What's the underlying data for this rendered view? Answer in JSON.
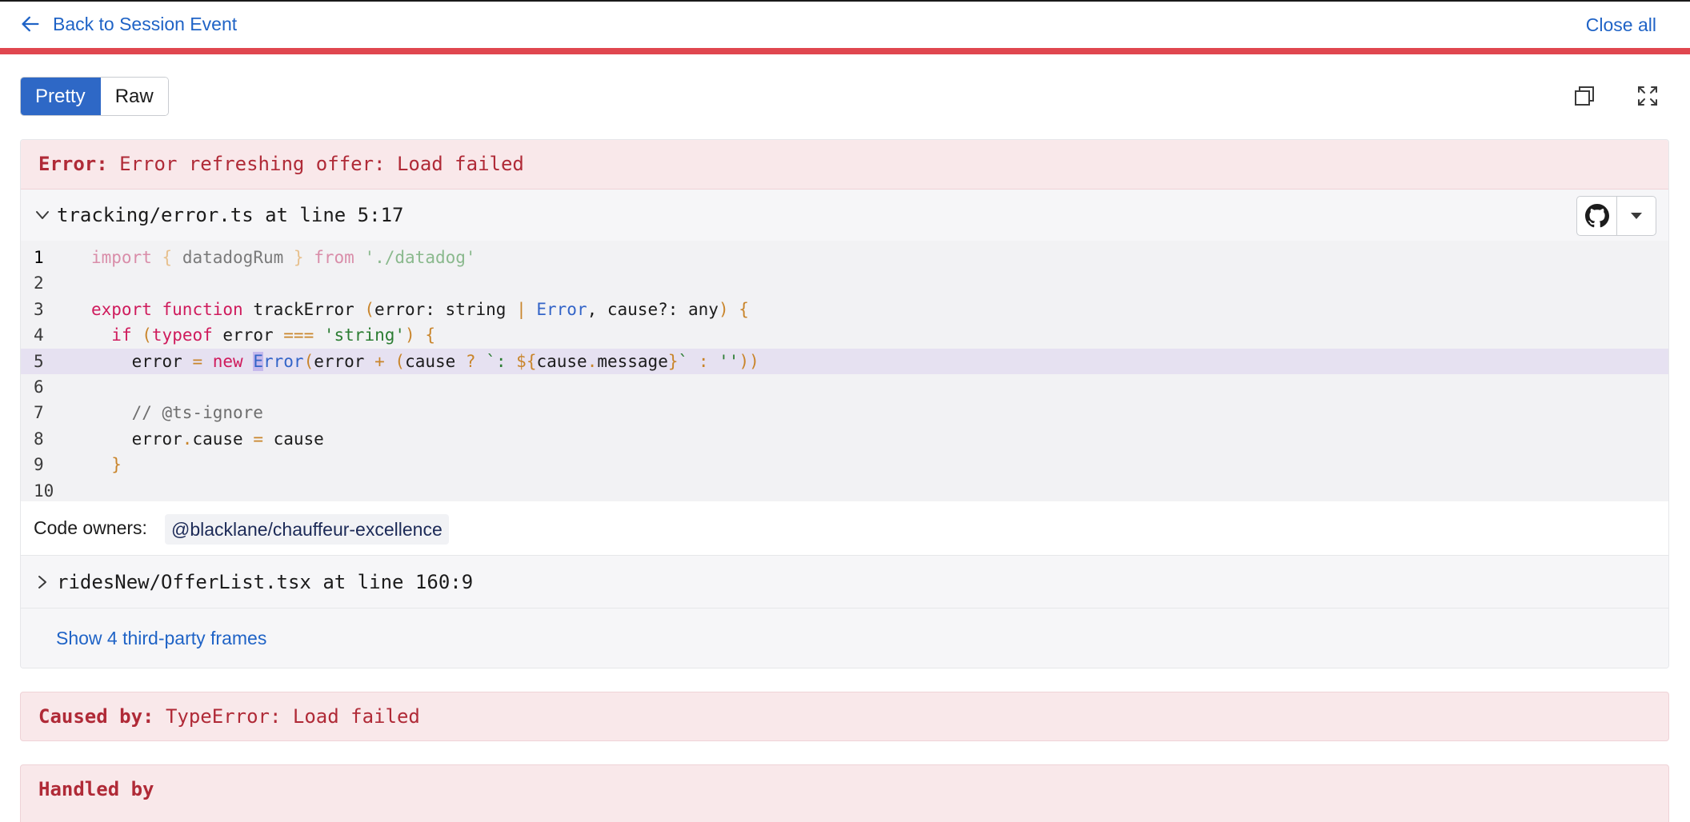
{
  "topbar": {
    "back_label": "Back to Session Event",
    "close_label": "Close all"
  },
  "view_toggle": {
    "pretty_label": "Pretty",
    "raw_label": "Raw",
    "selected": "Pretty"
  },
  "error": {
    "prefix": "Error:",
    "message": "Error refreshing offer: Load failed"
  },
  "frames": [
    {
      "title": "tracking/error.ts at line 5:17",
      "expanded": true,
      "highlighted_line": 5,
      "line_numbers": [
        "1",
        "2",
        "3",
        "4",
        "5",
        "6",
        "7",
        "8",
        "9",
        "10"
      ],
      "code_lines": [
        "import { datadogRum } from './datadog'",
        "",
        "export function trackError (error: string | Error, cause?: any) {",
        "  if (typeof error === 'string') {",
        "    error = new Error(error + (cause ? `: ${cause.message}` : ''))",
        "",
        "    // @ts-ignore",
        "    error.cause = cause",
        "  }",
        ""
      ]
    },
    {
      "title": "ridesNew/OfferList.tsx at line 160:9",
      "expanded": false
    }
  ],
  "code_owners": {
    "label": "Code owners:",
    "owner": "@blacklane/chauffeur-excellence"
  },
  "third_party": {
    "label": "Show 4 third-party frames"
  },
  "caused_by": {
    "prefix": "Caused by:",
    "message": "TypeError: Load failed"
  },
  "handled_by": {
    "label": "Handled by"
  },
  "colors": {
    "link_blue": "#1f63c6",
    "accent_blue": "#2e68c6",
    "error_red": "#b02a37",
    "error_bg": "#f9e8ea",
    "strip_red": "#e0474f",
    "highlight_line": "#e6e1f1"
  },
  "icons": [
    "arrow-left-icon",
    "copy-icon",
    "fullscreen-icon",
    "chevron-down-icon",
    "chevron-right-icon",
    "github-icon",
    "caret-down-icon"
  ]
}
